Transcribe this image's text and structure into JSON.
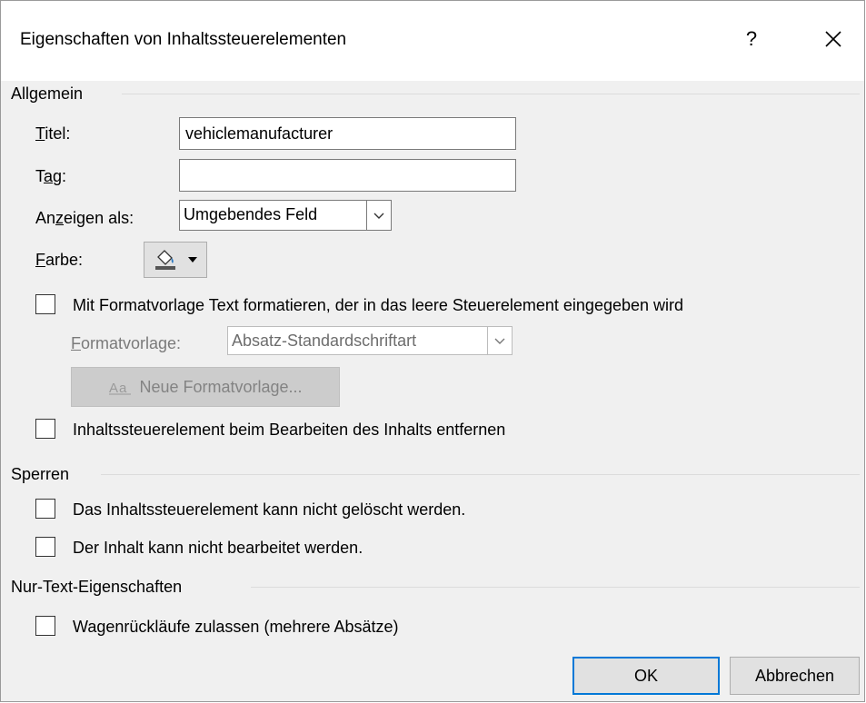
{
  "window": {
    "title": "Eigenschaften von Inhaltssteuerelementen",
    "help_label": "?"
  },
  "general": {
    "header": "Allgemein",
    "title_label": "Titel:",
    "title_value": "vehiclemanufacturer",
    "tag_label": "Tag:",
    "tag_value": "",
    "display_as_label": "Anzeigen als:",
    "display_as_value": "Umgebendes Feld",
    "color_label": "Farbe:",
    "use_style_checkbox_label": "Mit Formatvorlage Text formatieren, der in das leere Steuerelement eingegeben wird",
    "use_style_checked": false,
    "style_label": "Formatvorlage:",
    "style_value": "Absatz-Standardschriftart",
    "new_style_button": "Neue Formatvorlage...",
    "remove_on_edit_label": "Inhaltssteuerelement beim Bearbeiten des Inhalts entfernen",
    "remove_on_edit_checked": false
  },
  "locking": {
    "header": "Sperren",
    "cannot_delete_label": "Das Inhaltssteuerelement kann nicht gelöscht werden.",
    "cannot_delete_checked": false,
    "cannot_edit_label": "Der Inhalt kann nicht bearbeitet werden.",
    "cannot_edit_checked": false
  },
  "plain_text": {
    "header": "Nur-Text-Eigenschaften",
    "allow_returns_label": "Wagenrückläufe zulassen (mehrere Absätze)",
    "allow_returns_checked": false
  },
  "buttons": {
    "ok": "OK",
    "cancel": "Abbrechen"
  },
  "colors": {
    "default_button_border": "#0078d7",
    "dialog_background": "#f0f0f0"
  },
  "icons": {
    "close": "close-icon",
    "color": "paint-bucket-icon",
    "dropdown": "chevron-down-icon",
    "new_style": "new-style-icon"
  }
}
